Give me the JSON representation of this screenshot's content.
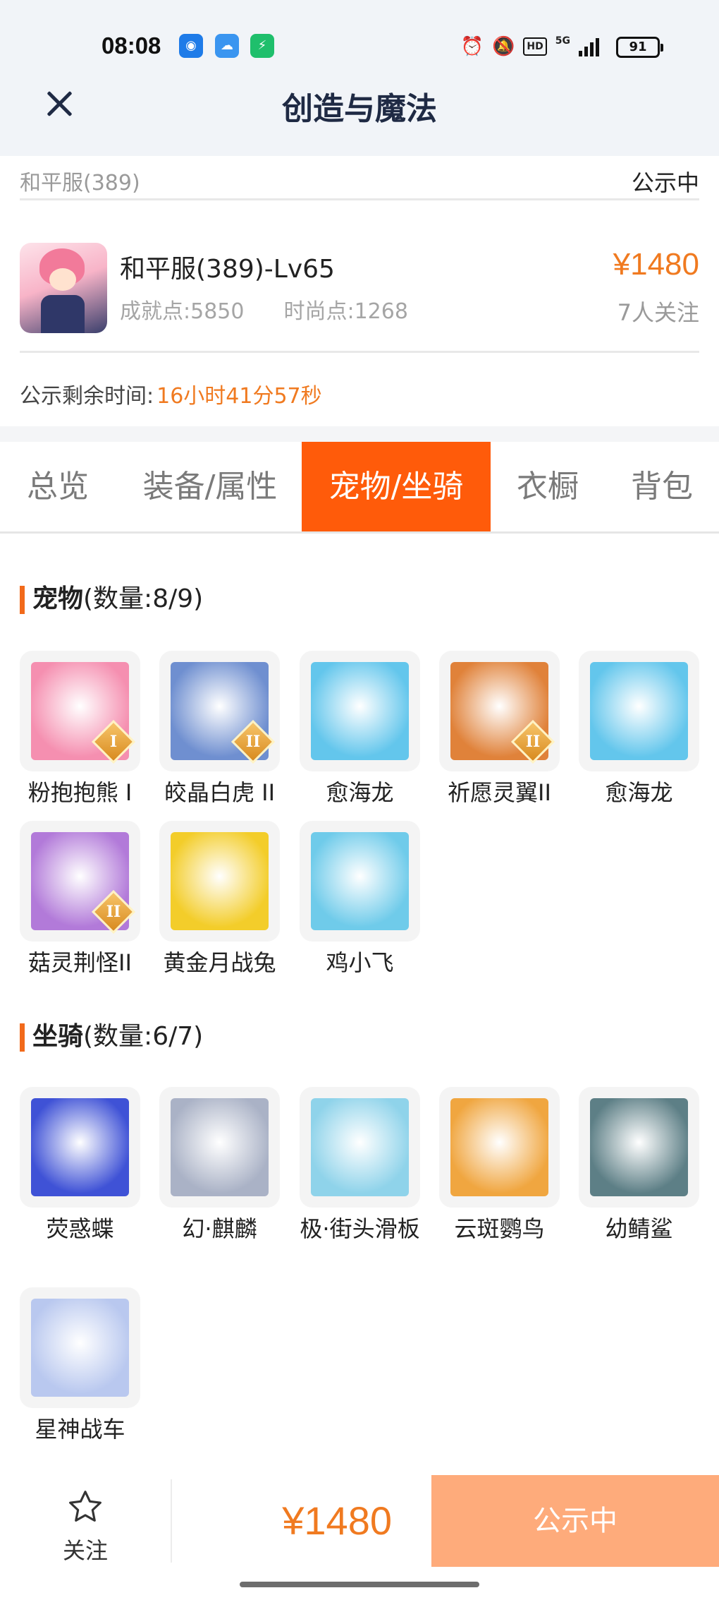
{
  "status_bar": {
    "time": "08:08",
    "battery": "91",
    "network": "5G",
    "hd": "HD",
    "icons": [
      "alarm-icon",
      "mute-icon",
      "hd-icon",
      "signal-icon",
      "battery-icon"
    ]
  },
  "header": {
    "title": "创造与魔法",
    "close_icon": "close-icon"
  },
  "summary": {
    "server": "和平服(389)",
    "status": "公示中",
    "role_name": "和平服(389)-Lv65",
    "achievement": "成就点:5850",
    "fashion": "时尚点:1268",
    "price": "¥1480",
    "followers": "7人关注",
    "countdown_label": "公示剩余时间:",
    "countdown_value": "16小时41分57秒"
  },
  "tabs": [
    {
      "label": "总览",
      "active": false
    },
    {
      "label": "装备/属性",
      "active": false
    },
    {
      "label": "宠物/坐骑",
      "active": true
    },
    {
      "label": "衣橱",
      "active": false
    },
    {
      "label": "背包",
      "active": false
    }
  ],
  "pets": {
    "title": "宠物",
    "count": "(数量:8/9)",
    "items": [
      {
        "name": "粉抱抱熊 I",
        "badge": "I",
        "color": "#f58fb0"
      },
      {
        "name": "皎晶白虎 II",
        "badge": "II",
        "color": "#6f8fd0"
      },
      {
        "name": "愈海龙",
        "badge": "",
        "color": "#63c6ec"
      },
      {
        "name": "祈愿灵翼II",
        "badge": "II",
        "color": "#e0823a"
      },
      {
        "name": "愈海龙",
        "badge": "",
        "color": "#63c6ec"
      },
      {
        "name": "菇灵荆怪II",
        "badge": "II",
        "color": "#b27ad9"
      },
      {
        "name": "黄金月战兔",
        "badge": "",
        "color": "#f3cd2a"
      },
      {
        "name": "鸡小飞",
        "badge": "",
        "color": "#6fcbea"
      }
    ]
  },
  "mounts": {
    "title": "坐骑",
    "count": "(数量:6/7)",
    "items": [
      {
        "name": "荧惑蝶",
        "color": "#3f52d6"
      },
      {
        "name": "幻·麒麟",
        "color": "#aab2c6"
      },
      {
        "name": "极·街头滑板",
        "color": "#8fd3ea"
      },
      {
        "name": "云斑鹦鸟",
        "color": "#f0a640"
      },
      {
        "name": "幼鲭鲨",
        "color": "#5d7f86"
      },
      {
        "name": "星神战车",
        "color": "#b9c8ef"
      }
    ]
  },
  "bottom_bar": {
    "follow_label": "关注",
    "price": "¥1480",
    "action_label": "公示中"
  },
  "colors": {
    "accent": "#ff5b0a",
    "price": "#f07a20",
    "action_button": "#feab7b"
  }
}
